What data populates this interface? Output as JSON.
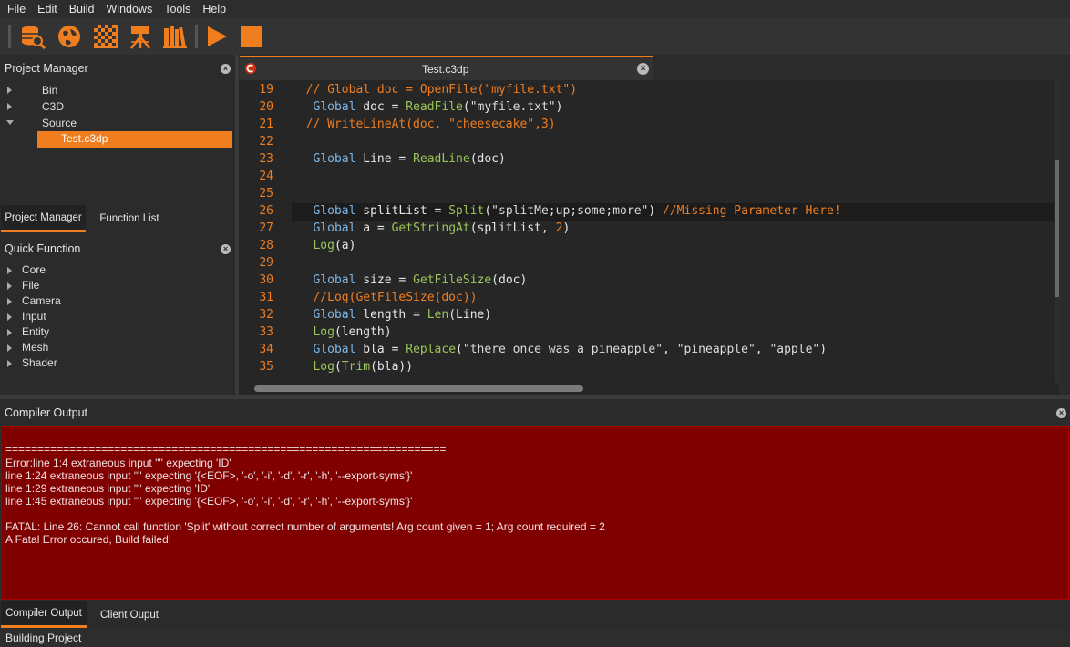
{
  "menu": [
    "File",
    "Edit",
    "Build",
    "Windows",
    "Tools",
    "Help"
  ],
  "toolbar_icons": [
    "database-search-icon",
    "globe-icon",
    "checker-texture-icon",
    "camera-tripod-icon",
    "library-books-icon",
    "play-icon",
    "stop-icon"
  ],
  "colors": {
    "accent": "#f07d1e",
    "error_bg": "#800000"
  },
  "project_manager": {
    "title": "Project Manager",
    "items": [
      "Bin",
      "C3D",
      "Source",
      "Test.c3dp"
    ],
    "tabs": [
      "Project Manager",
      "Function List"
    ]
  },
  "quick_function": {
    "title": "Quick Function",
    "items": [
      "Core",
      "File",
      "Camera",
      "Input",
      "Entity",
      "Mesh",
      "Shader"
    ]
  },
  "editor": {
    "tab_title": "Test.c3dp",
    "lines": [
      {
        "n": "19",
        "code": "  // Global doc = OpenFile(\"myfile.txt\")"
      },
      {
        "n": "20",
        "code": "   Global doc = ReadFile(\"myfile.txt\")"
      },
      {
        "n": "21",
        "code": "  // WriteLineAt(doc, \"cheesecake\",3)"
      },
      {
        "n": "22",
        "code": ""
      },
      {
        "n": "23",
        "code": "   Global Line = ReadLine(doc)"
      },
      {
        "n": "24",
        "code": ""
      },
      {
        "n": "25",
        "code": ""
      },
      {
        "n": "26",
        "code": "   Global splitList = Split(\"splitMe;up;some;more\") //Missing Parameter Here!"
      },
      {
        "n": "27",
        "code": "   Global a = GetStringAt(splitList, 2)"
      },
      {
        "n": "28",
        "code": "   Log(a)"
      },
      {
        "n": "29",
        "code": ""
      },
      {
        "n": "30",
        "code": "   Global size = GetFileSize(doc)"
      },
      {
        "n": "31",
        "code": "   //Log(GetFileSize(doc))"
      },
      {
        "n": "32",
        "code": "   Global length = Len(Line)"
      },
      {
        "n": "33",
        "code": "   Log(length)"
      },
      {
        "n": "34",
        "code": "   Global bla = Replace(\"there once was a pineapple\", \"pineapple\", \"apple\")"
      },
      {
        "n": "35",
        "code": "   Log(Trim(bla))"
      }
    ]
  },
  "compiler_output": {
    "title": "Compiler Output",
    "lines": [
      "=====================================================================",
      "Error:line 1:4 extraneous input '\"' expecting 'ID'",
      "line 1:24 extraneous input '\"' expecting '{<EOF>, '-o', '-i', '-d', '-r', '-h', '--export-syms'}'",
      "line 1:29 extraneous input '\"' expecting 'ID'",
      "line 1:45 extraneous input '\"' expecting '{<EOF>, '-o', '-i', '-d', '-r', '-h', '--export-syms'}'",
      "",
      "FATAL: Line 26: Cannot call function 'Split' without correct number of arguments! Arg count given = 1; Arg count required = 2",
      "A Fatal Error occured, Build failed!"
    ],
    "tabs": [
      "Compiler Output",
      "Client Ouput"
    ]
  },
  "status": "Building Project"
}
